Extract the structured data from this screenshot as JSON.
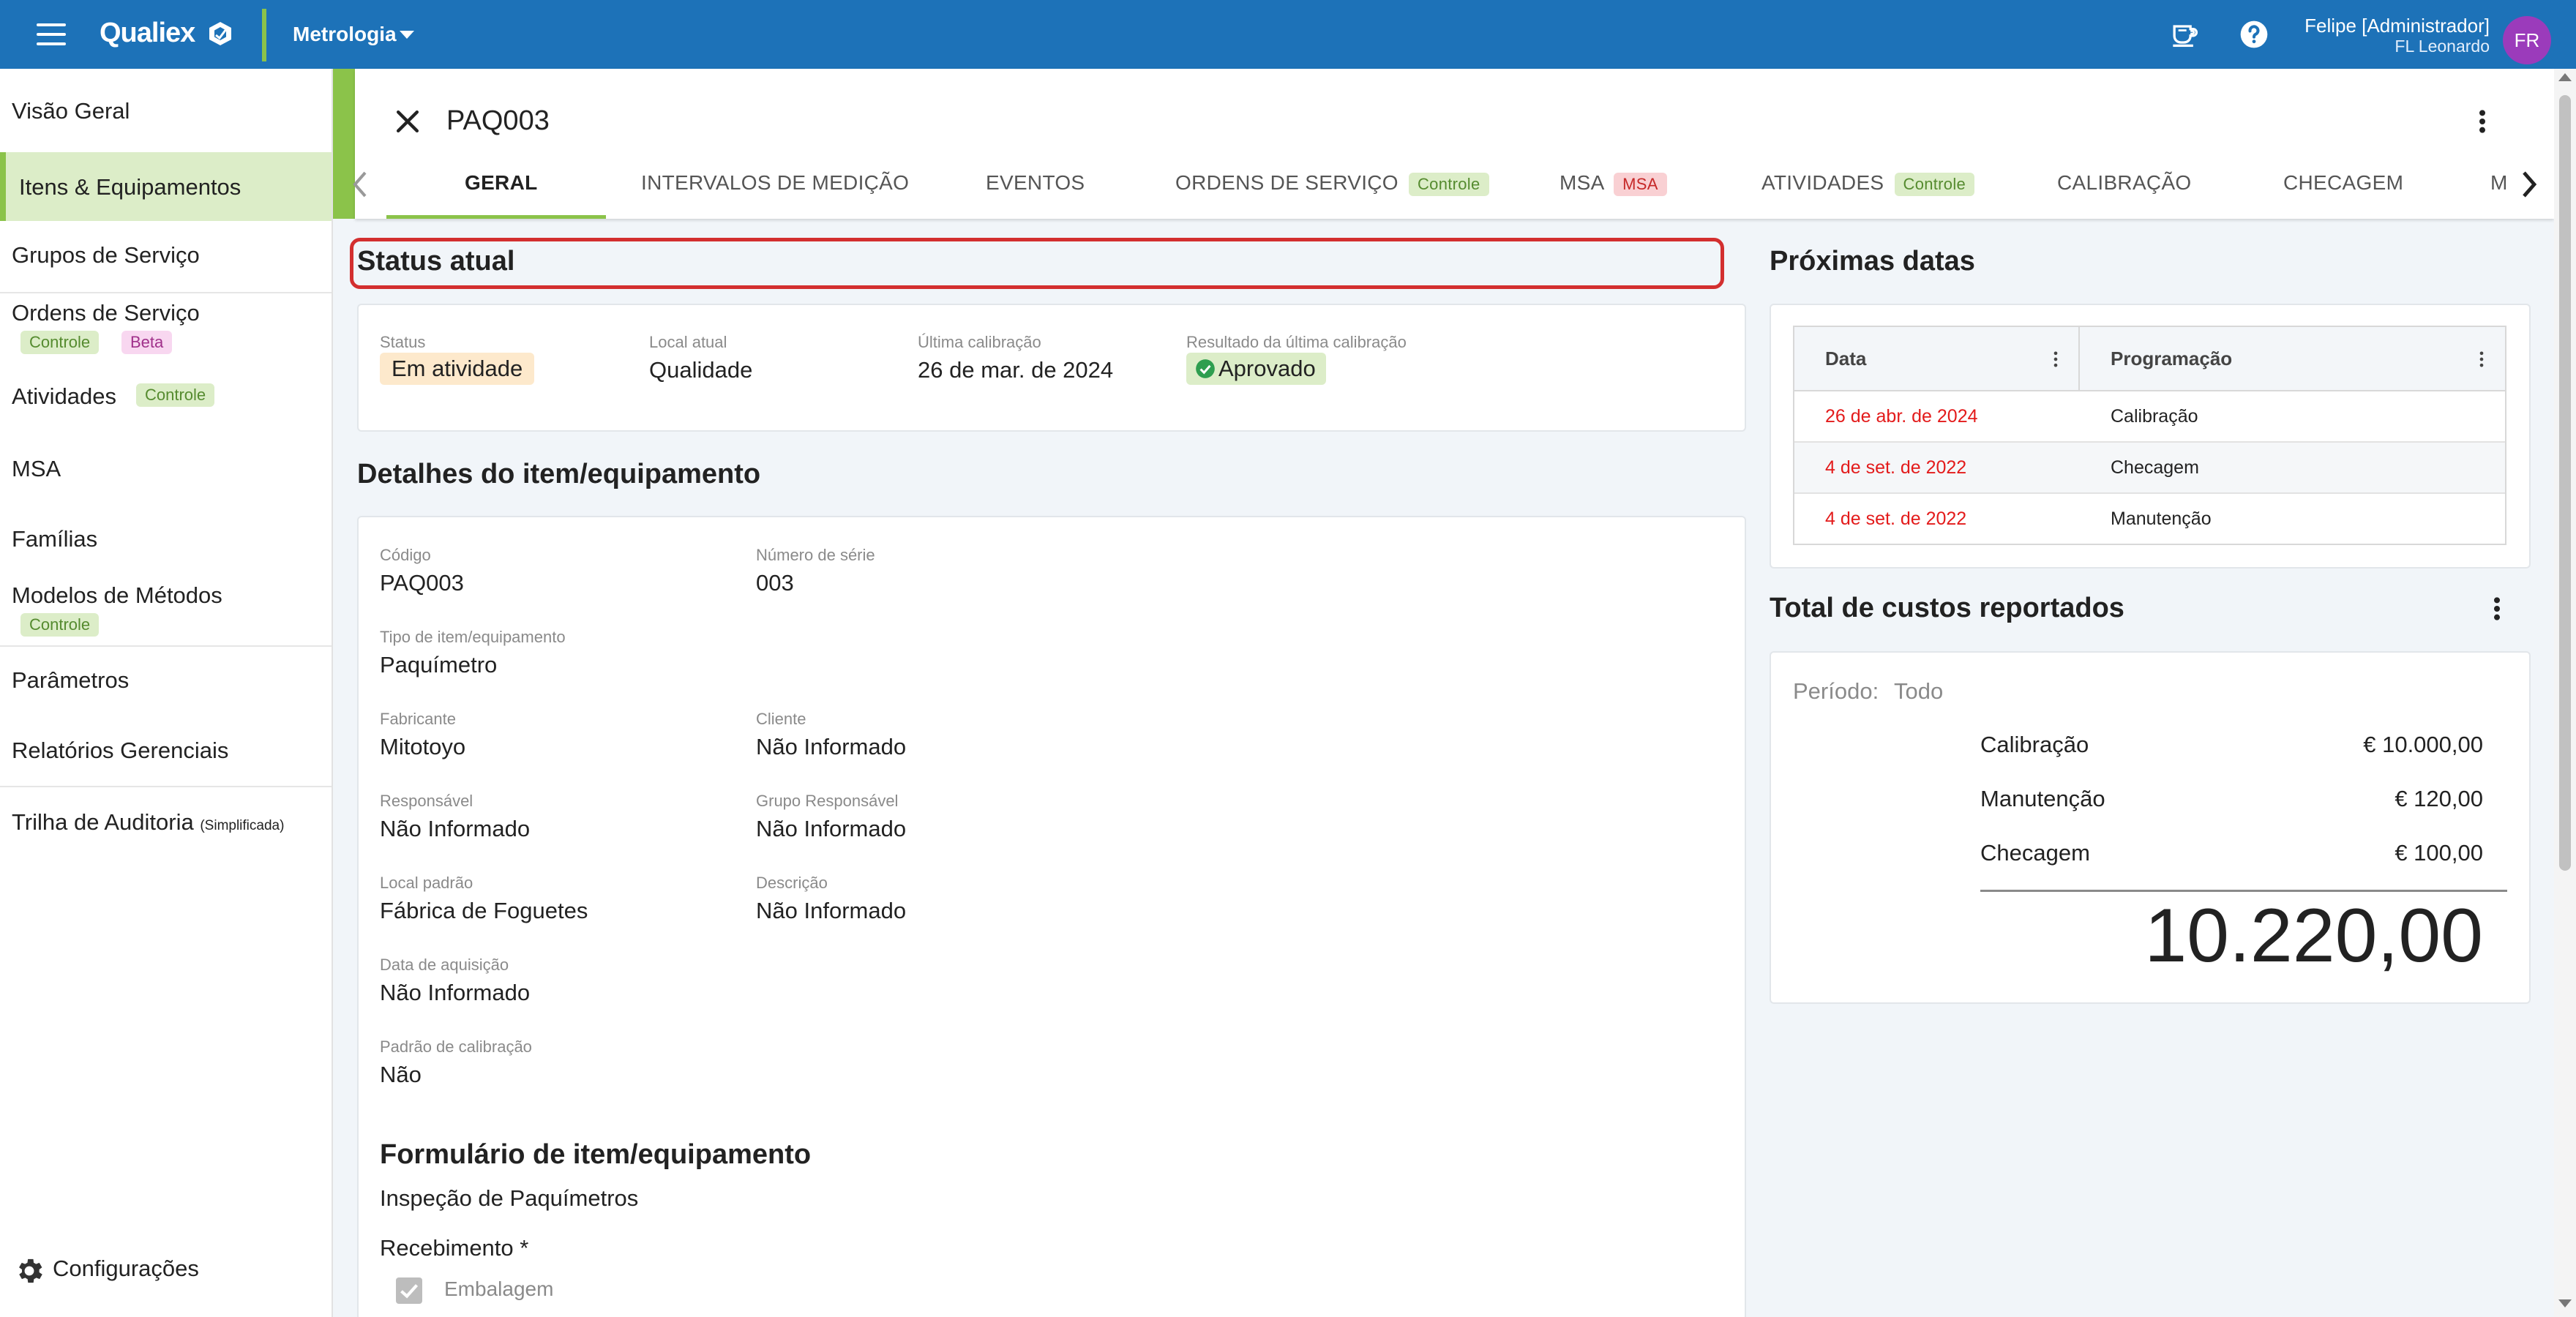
{
  "topbar": {
    "brand": "Qualiex",
    "module": "Metrologia",
    "user_name": "Felipe [Administrador]",
    "user_sub": "FL Leonardo",
    "avatar_initials": "FR",
    "icons": [
      "menu-icon",
      "coffee-cup-icon",
      "help-icon"
    ]
  },
  "sidebar": {
    "items": [
      {
        "label": "Visão Geral"
      },
      {
        "label": "Itens & Equipamentos"
      },
      {
        "label": "Grupos de Serviço"
      },
      {
        "label": "Ordens de Serviço",
        "chips": [
          "Controle",
          "Beta"
        ]
      },
      {
        "label": "Atividades",
        "chips": [
          "Controle"
        ]
      },
      {
        "label": "MSA"
      },
      {
        "label": "Famílias"
      },
      {
        "label": "Modelos de Métodos",
        "chips": [
          "Controle"
        ]
      },
      {
        "label": "Parâmetros"
      },
      {
        "label": "Relatórios Gerenciais"
      },
      {
        "label": "Trilha de Auditoria",
        "suffix": "(Simplificada)"
      }
    ],
    "config_label": "Configurações"
  },
  "header": {
    "title": "PAQ003",
    "tabs": [
      {
        "label": "GERAL",
        "active": true
      },
      {
        "label": "INTERVALOS DE MEDIÇÃO"
      },
      {
        "label": "EVENTOS"
      },
      {
        "label": "ORDENS DE SERVIÇO",
        "chip": "Controle"
      },
      {
        "label": "MSA",
        "chip": "MSA"
      },
      {
        "label": "ATIVIDADES",
        "chip": "Controle"
      },
      {
        "label": "CALIBRAÇÃO"
      },
      {
        "label": "CHECAGEM"
      },
      {
        "label": "M"
      }
    ]
  },
  "status": {
    "title": "Status atual",
    "status_label": "Status",
    "status_value": "Em atividade",
    "local_label": "Local atual",
    "local_value": "Qualidade",
    "last_cal_label": "Última calibração",
    "last_cal_value": "26 de mar. de 2024",
    "result_label": "Resultado da última calibração",
    "result_value": "Aprovado"
  },
  "details": {
    "title": "Detalhes do item/equipamento",
    "codigo_label": "Código",
    "codigo_value": "PAQ003",
    "serie_label": "Número de série",
    "serie_value": "003",
    "tipo_label": "Tipo de item/equipamento",
    "tipo_value": "Paquímetro",
    "fabricante_label": "Fabricante",
    "fabricante_value": "Mitotoyo",
    "cliente_label": "Cliente",
    "cliente_value": "Não Informado",
    "responsavel_label": "Responsável",
    "responsavel_value": "Não Informado",
    "grupo_label": "Grupo Responsável",
    "grupo_value": "Não Informado",
    "local_label": "Local padrão",
    "local_value": "Fábrica de Foguetes",
    "descricao_label": "Descrição",
    "descricao_value": "Não Informado",
    "aquisicao_label": "Data de aquisição",
    "aquisicao_value": "Não Informado",
    "padrao_label": "Padrão de calibração",
    "padrao_value": "Não"
  },
  "form": {
    "title": "Formulário de item/equipamento",
    "subtitle": "Inspeção de Paquímetros",
    "section": "Recebimento *",
    "checkbox_label": "Embalagem"
  },
  "next_dates": {
    "title": "Próximas datas",
    "col_date": "Data",
    "col_prog": "Programação",
    "rows": [
      {
        "date": "26 de abr. de 2024",
        "prog": "Calibração"
      },
      {
        "date": "4 de set. de 2022",
        "prog": "Checagem"
      },
      {
        "date": "4 de set. de 2022",
        "prog": "Manutenção"
      }
    ],
    "date_color": "#e31b1b"
  },
  "costs": {
    "title": "Total de custos reportados",
    "period_label": "Período:",
    "period_value": "Todo",
    "items": [
      {
        "label": "Calibração",
        "value": "€ 10.000,00"
      },
      {
        "label": "Manutenção",
        "value": "€ 120,00"
      },
      {
        "label": "Checagem",
        "value": "€ 100,00"
      }
    ],
    "total": "10.220,00"
  },
  "colors": {
    "topbar": "#1d72b8",
    "accent_green": "#8bc34a",
    "highlight_red": "#d32f2f",
    "avatar": "#9b3bbb"
  }
}
